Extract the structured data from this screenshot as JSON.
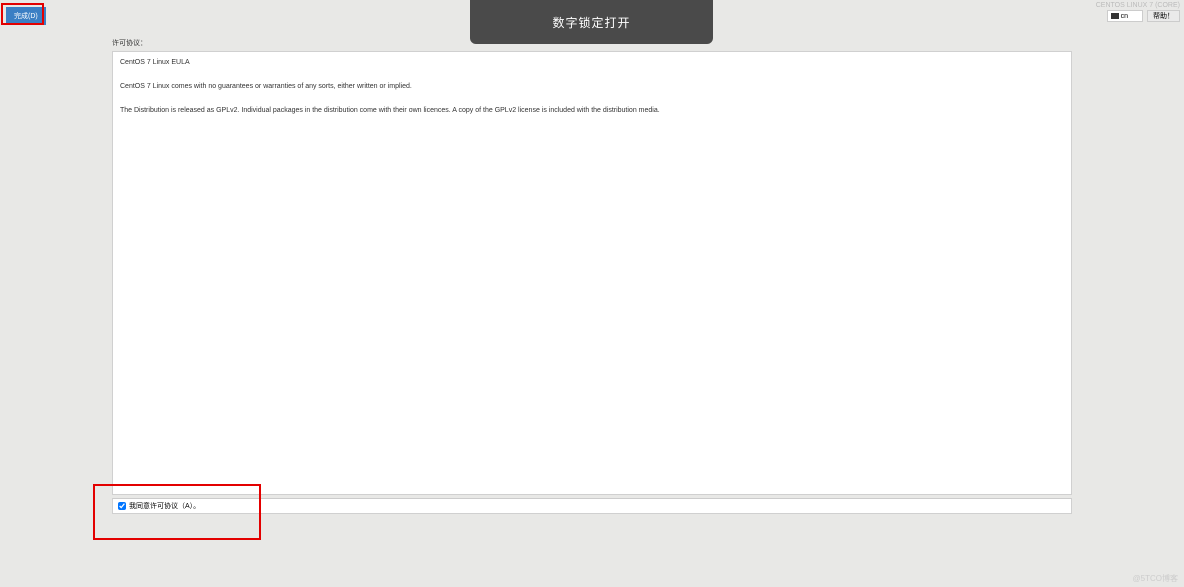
{
  "header": {
    "os_info": "CENTOS LINUX 7 (CORE)",
    "done_button": "完成(D)",
    "lang_code": "cn",
    "help_button": "帮助！"
  },
  "overlay": {
    "numlock": "数字锁定打开"
  },
  "license": {
    "label": "许可协议：",
    "eula_title": "CentOS 7 Linux EULA",
    "eula_para1": "CentOS 7 Linux comes with no guarantees or warranties of any sorts, either written or implied.",
    "eula_para2": "The Distribution is released as GPLv2. Individual packages in the distribution come with their own licences. A copy of the GPLv2 license is included with the distribution media."
  },
  "agree": {
    "checked": true,
    "label": "我同意许可协议（A）。"
  },
  "watermark": "@5TCO博客"
}
